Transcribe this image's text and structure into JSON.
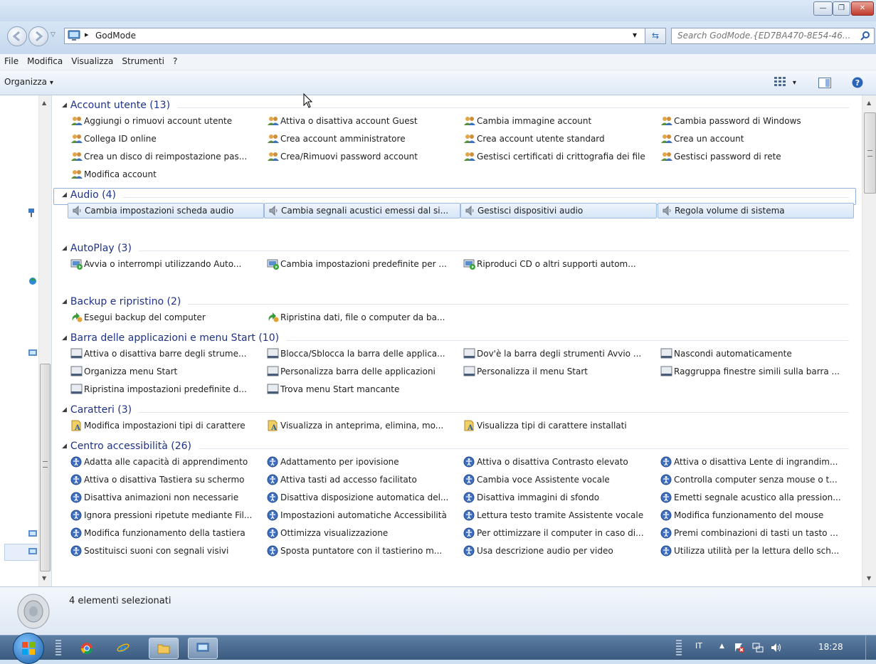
{
  "window": {
    "controls": {
      "minimize": "—",
      "maximize": "❐",
      "close": "✕"
    }
  },
  "address": {
    "path_arrow": "▸",
    "path": "GodMode",
    "dropdown": "▾",
    "refresh": "⇆",
    "search_placeholder": "Search GodMode.{ED7BA470-8E54-46..."
  },
  "menu": [
    "File",
    "Modifica",
    "Visualizza",
    "Strumenti",
    "?"
  ],
  "commandbar": {
    "organize": "Organizza",
    "organize_arrow": "▾"
  },
  "groups": [
    {
      "title": "Account utente (13)",
      "icon": "users-icon",
      "items": [
        "Aggiungi o rimuovi account utente",
        "Attiva o disattiva account Guest",
        "Cambia immagine account",
        "Cambia password di Windows",
        "Collega ID online",
        "Crea account amministratore",
        "Crea account utente standard",
        "Crea un account",
        "Crea un disco di reimpostazione pas...",
        "Crea/Rimuovi password account",
        "Gestisci certificati di crittografia dei file",
        "Gestisci password di rete",
        "Modifica account"
      ]
    },
    {
      "title": "Audio (4)",
      "icon": "speaker-icon",
      "items": [
        "Cambia impostazioni scheda audio",
        "Cambia segnali acustici emessi dal si...",
        "Gestisci dispositivi audio",
        "Regola volume di sistema"
      ]
    },
    {
      "title": "AutoPlay (3)",
      "icon": "autoplay-icon",
      "items": [
        "Avvia o interrompi utilizzando Auto...",
        "Cambia impostazioni predefinite per ...",
        "Riproduci CD o altri supporti autom..."
      ]
    },
    {
      "title": "Backup e ripristino (2)",
      "icon": "backup-icon",
      "items": [
        "Esegui backup del computer",
        "Ripristina dati, file o computer da ba..."
      ]
    },
    {
      "title": "Barra delle applicazioni e menu Start (10)",
      "icon": "taskbar-icon",
      "items": [
        "Attiva o disattiva barre degli strume...",
        "Blocca/Sblocca la barra delle applica...",
        "Dov'è la barra degli strumenti Avvio ...",
        "Nascondi automaticamente",
        "Organizza menu Start",
        "Personalizza barra delle applicazioni",
        "Personalizza il menu Start",
        "Raggruppa finestre simili sulla barra ...",
        "Ripristina impostazioni predefinite d...",
        "Trova menu Start mancante"
      ]
    },
    {
      "title": "Caratteri (3)",
      "icon": "fonts-icon",
      "items": [
        "Modifica impostazioni tipi di carattere",
        "Visualizza in anteprima, elimina, mo...",
        "Visualizza tipi di carattere installati"
      ]
    },
    {
      "title": "Centro accessibilità (26)",
      "icon": "accessibility-icon",
      "items": [
        "Adatta alle capacità di apprendimento",
        "Adattamento per ipovisione",
        "Attiva o disattiva Contrasto elevato",
        "Attiva o disattiva Lente di ingrandim...",
        "Attiva o disattiva Tastiera su schermo",
        "Attiva tasti ad accesso facilitato",
        "Cambia voce Assistente vocale",
        "Controlla computer senza mouse o t...",
        "Disattiva animazioni non necessarie",
        "Disattiva disposizione automatica del...",
        "Disattiva immagini di sfondo",
        "Emetti segnale acustico alla pression...",
        "Ignora pressioni ripetute mediante Fil...",
        "Impostazioni automatiche Accessibilità",
        "Lettura testo tramite Assistente vocale",
        "Modifica funzionamento del mouse",
        "Modifica funzionamento della tastiera",
        "Ottimizza visualizzazione",
        "Per ottimizzare il computer in caso di...",
        "Premi combinazioni di tasti un tasto ...",
        "Sostituisci suoni con segnali visivi",
        "Sposta puntatore con il tastierino m...",
        "Usa descrizione audio per video",
        "Utilizza utilità per la lettura dello sch..."
      ]
    }
  ],
  "details": {
    "status": "4 elementi selezionati"
  },
  "taskbar": {
    "lang": "IT",
    "tray_arrow": "▲",
    "clock": "18:28"
  }
}
